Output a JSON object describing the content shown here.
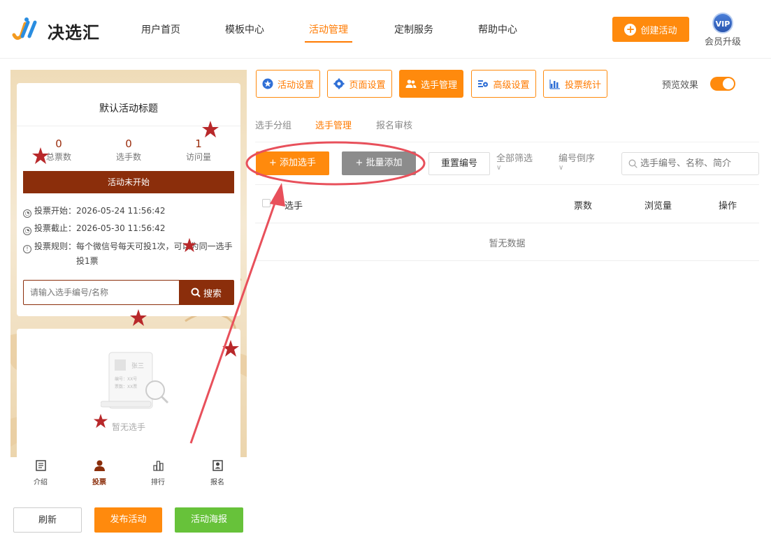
{
  "header": {
    "logo_text": "决选汇",
    "nav": [
      "用户首页",
      "模板中心",
      "活动管理",
      "定制服务",
      "帮助中心"
    ],
    "active_nav": "活动管理",
    "create_button": "创建活动",
    "vip_badge": "VIP",
    "vip_label": "会员升级"
  },
  "preview": {
    "title": "默认活动标题",
    "stats": [
      {
        "value": "0",
        "label": "总票数"
      },
      {
        "value": "0",
        "label": "选手数"
      },
      {
        "value": "1",
        "label": "访问量"
      }
    ],
    "status": "活动未开始",
    "vote_start": "投票开始：2026-05-24 11:56:42",
    "vote_end": "投票截止：2026-05-30 11:56:42",
    "vote_rule_line1": "投票规则：每个微信号每天可投1次，可以为同一选手",
    "vote_rule_line2": "投1票",
    "search_placeholder": "请输入选手编号/名称",
    "search_button": "搜索",
    "empty_text": "暂无选手",
    "empty_card_name": "张三",
    "empty_card_no": "编号：XX号",
    "empty_card_votes": "票数：XX票",
    "tabs": [
      "介绍",
      "投票",
      "排行",
      "报名"
    ],
    "active_tab": "投票"
  },
  "bottom_buttons": {
    "refresh": "刷新",
    "publish": "发布活动",
    "poster": "活动海报"
  },
  "toolbar": {
    "buttons": [
      "活动设置",
      "页面设置",
      "选手管理",
      "高级设置",
      "投票统计"
    ],
    "active": "选手管理",
    "preview_label": "预览效果",
    "preview_on": true
  },
  "subtabs": [
    "选手分组",
    "选手管理",
    "报名审核"
  ],
  "active_subtab": "选手管理",
  "actions": {
    "add": "+ 添加选手",
    "batch": "+ 批量添加",
    "renumber": "重置编号",
    "filter": "全部筛选",
    "sort": "编号倒序",
    "search_placeholder": "选手编号、名称、简介"
  },
  "table": {
    "columns": [
      "选手",
      "票数",
      "浏览量",
      "操作"
    ],
    "empty": "暂无数据"
  },
  "colors": {
    "accent": "#ff8a0d",
    "theme_dark_red": "#8b2e0b",
    "green": "#67c23a",
    "annotation": "#e8505b"
  }
}
